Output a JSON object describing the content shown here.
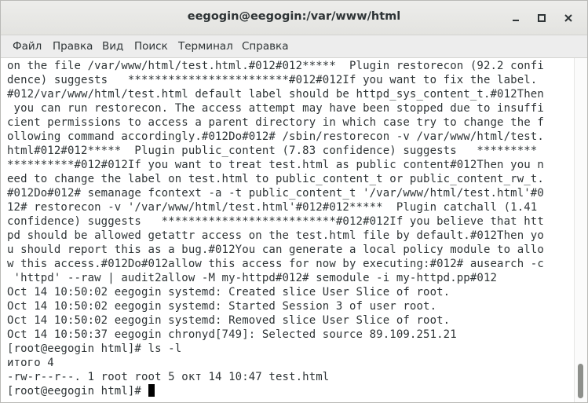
{
  "window": {
    "title": "eegogin@eegogin:/var/www/html"
  },
  "menu": {
    "items": [
      "Файл",
      "Правка",
      "Вид",
      "Поиск",
      "Терминал",
      "Справка"
    ]
  },
  "terminal": {
    "lines": [
      "on the file /var/www/html/test.html.#012#012*****  Plugin restorecon (92.2 confi",
      "dence) suggests   ************************#012#012If you want to fix the label.",
      "#012/var/www/html/test.html default label should be httpd_sys_content_t.#012Then",
      " you can run restorecon. The access attempt may have been stopped due to insuffi",
      "cient permissions to access a parent directory in which case try to change the f",
      "ollowing command accordingly.#012Do#012# /sbin/restorecon -v /var/www/html/test.",
      "html#012#012*****  Plugin public_content (7.83 confidence) suggests   *********",
      "**********#012#012If you want to treat test.html as public content#012Then you n",
      "eed to change the label on test.html to public_content_t or public_content_rw_t.",
      "#012Do#012# semanage fcontext -a -t public_content_t '/var/www/html/test.html'#0",
      "12# restorecon -v '/var/www/html/test.html'#012#012*****  Plugin catchall (1.41",
      "confidence) suggests   **************************#012#012If you believe that htt",
      "pd should be allowed getattr access on the test.html file by default.#012Then yo",
      "u should report this as a bug.#012You can generate a local policy module to allo",
      "w this access.#012Do#012allow this access for now by executing:#012# ausearch -c",
      " 'httpd' --raw | audit2allow -M my-httpd#012# semodule -i my-httpd.pp#012",
      "Oct 14 10:50:02 eegogin systemd: Created slice User Slice of root.",
      "Oct 14 10:50:02 eegogin systemd: Started Session 3 of user root.",
      "Oct 14 10:50:02 eegogin systemd: Removed slice User Slice of root.",
      "Oct 14 10:50:37 eegogin chronyd[749]: Selected source 89.109.251.21",
      "[root@eegogin html]# ls -l",
      "итого 4",
      "-rw-r--r--. 1 root root 5 окт 14 10:47 test.html"
    ],
    "prompt": "[root@eegogin html]# "
  },
  "colors": {
    "terminal_bg": "#ffffff",
    "terminal_fg": "#2e3436",
    "titlebar_bg": "#e8e8e7",
    "menubar_bg": "#ededed"
  },
  "icons": {
    "minimize": "minimize-icon",
    "maximize": "maximize-icon",
    "close": "close-icon"
  }
}
